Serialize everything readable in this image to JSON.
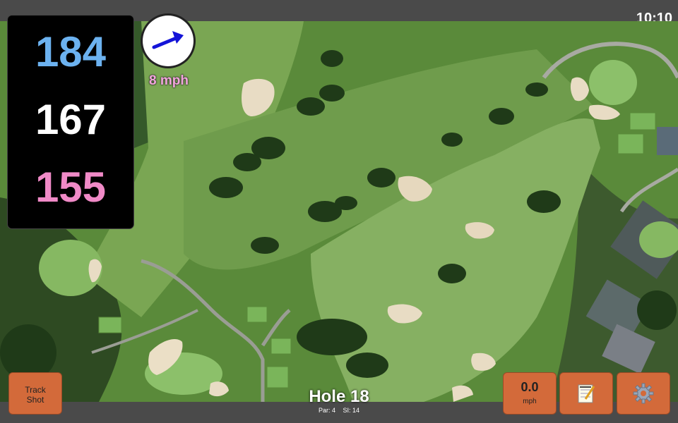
{
  "status_bar": {
    "time": "10:10"
  },
  "distances": {
    "back": "184",
    "middle": "167",
    "front": "155"
  },
  "wind": {
    "speed_label": "8 mph",
    "direction": "blue-arrow-icon"
  },
  "buttons": {
    "track_shot": "Track\nShot",
    "speed_value": "0.0",
    "speed_unit": "mph",
    "notes_icon": "notepad-icon",
    "settings_icon": "gear-icon"
  },
  "hole": {
    "title": "Hole 18",
    "par": "Par: 4",
    "si": "SI: 14"
  },
  "colors": {
    "back": "#6cb2f0",
    "middle": "#ffffff",
    "front": "#f08ac7",
    "button": "#d36a3a",
    "wind_text": "#f2a6dc"
  }
}
